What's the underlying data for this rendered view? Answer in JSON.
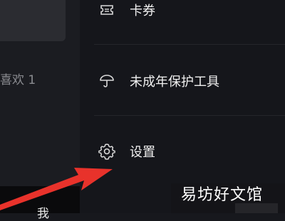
{
  "left_panel": {
    "likes_text": "喜欢 1",
    "me_tab": "我"
  },
  "menu": {
    "items": [
      {
        "label": "卡券",
        "icon": "coupon-icon"
      },
      {
        "label": "未成年保护工具",
        "icon": "umbrella-icon"
      },
      {
        "label": "设置",
        "icon": "gear-icon"
      }
    ]
  },
  "watermark": {
    "text": "易坊好文馆"
  },
  "colors": {
    "background": "#17181d",
    "arrow": "#e8322b",
    "text": "#f0f0f0"
  }
}
